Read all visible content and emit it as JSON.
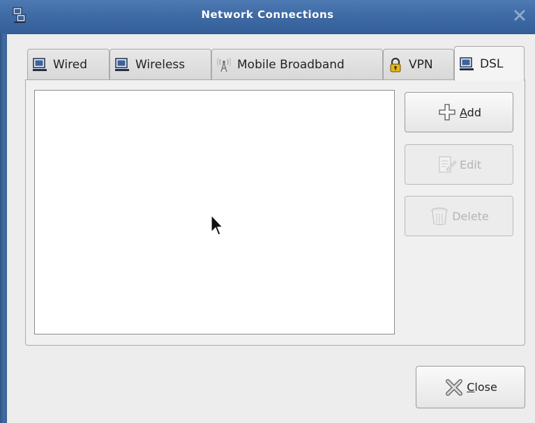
{
  "window": {
    "title": "Network Connections"
  },
  "tabs": [
    {
      "label": "Wired",
      "icon": "network-wired-icon",
      "active": false
    },
    {
      "label": "Wireless",
      "icon": "network-wireless-icon",
      "active": false
    },
    {
      "label": "Mobile Broadband",
      "icon": "antenna-icon",
      "active": false
    },
    {
      "label": "VPN",
      "icon": "lock-icon",
      "active": false
    },
    {
      "label": "DSL",
      "icon": "network-dsl-icon",
      "active": true
    }
  ],
  "connections_list": {
    "items": []
  },
  "buttons": {
    "add": {
      "first": "A",
      "rest": "dd",
      "icon": "plus-icon",
      "enabled": true
    },
    "edit": {
      "label": "Edit",
      "icon": "edit-icon",
      "enabled": false
    },
    "delete": {
      "label": "Delete",
      "icon": "trash-icon",
      "enabled": false
    },
    "close": {
      "first": "C",
      "rest": "lose",
      "icon": "close-x-icon",
      "enabled": true
    }
  },
  "colors": {
    "titlebar": "#3f6ba6",
    "window_bg": "#ededed",
    "list_bg": "#ffffff"
  }
}
